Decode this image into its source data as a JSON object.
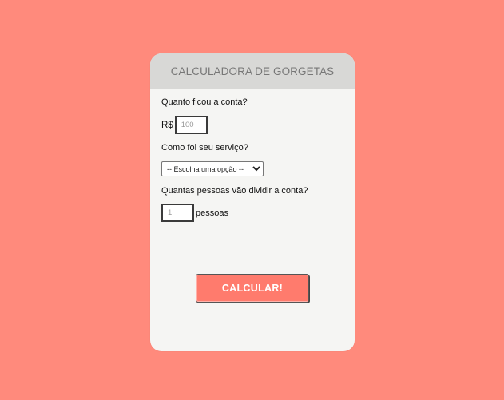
{
  "header": {
    "title": "CALCULADORA DE GORGETAS"
  },
  "bill": {
    "label": "Quanto ficou a conta?",
    "currency": "R$",
    "placeholder": "100"
  },
  "service": {
    "label": "Como foi seu serviço?",
    "selected": "-- Escolha uma opção --"
  },
  "people": {
    "label": "Quantas pessoas vão dividir a conta?",
    "placeholder": "1",
    "unit": "pessoas"
  },
  "action": {
    "calculate_label": "CALCULAR!"
  },
  "colors": {
    "background": "#ff8a7c",
    "card": "#f5f5f3",
    "header": "#d8d8d6",
    "button": "#ff7b6d"
  }
}
